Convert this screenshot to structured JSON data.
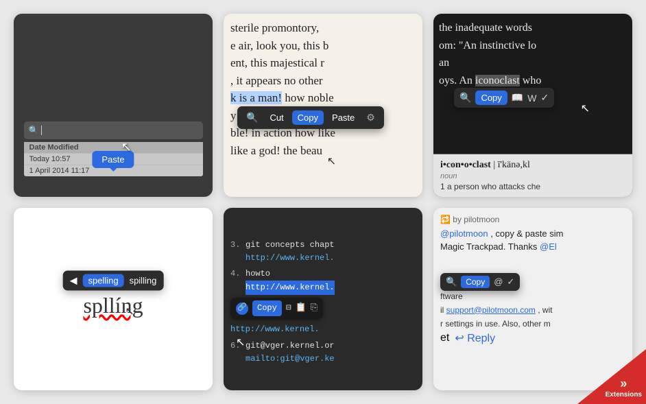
{
  "cards": {
    "card1": {
      "paste_label": "Paste",
      "search_placeholder": "",
      "file_header": "Date Modified",
      "file_row1": "Today 10:57",
      "file_row2": "1 April 2014 11:17"
    },
    "card2": {
      "text_lines": [
        "sterile promontory,",
        "e air, look you, this b",
        "ent, this majestical r",
        ", it appears no other",
        "k is a man!",
        " how noble",
        "y! in form and movi",
        "ble! in action how like",
        " like a god! the beau"
      ],
      "highlighted_text": "k is a man!",
      "menu_items": [
        "Cut",
        "Copy",
        "Paste"
      ],
      "menu_icon": "⚙",
      "search_icon": "🔍",
      "active_btn": "Copy"
    },
    "card3": {
      "text_lines": [
        "the inadequate words",
        "om: \"An instinctive lo",
        "an",
        "oys. An iconoclast who"
      ],
      "highlighted_word": "iconoclast",
      "toolbar": {
        "search_icon": "🔍",
        "copy_label": "Copy",
        "book_icon": "📖",
        "w_icon": "W",
        "check_icon": "✓",
        "active": "Copy"
      },
      "dict": {
        "headword": "i•con•o•clast",
        "pronunciation": "| ī'känə,kl",
        "pos": "noun",
        "definition": "1 a person who attacks che"
      }
    },
    "card4": {
      "tooltip": {
        "arrow": "◀",
        "word": "spelling",
        "suggestion": "spilling"
      },
      "misspelled": "spllíng"
    },
    "card5": {
      "lines": [
        {
          "number": "3.",
          "text": "  git concepts chapt",
          "url": "http://www.kernel."
        },
        {
          "number": "4.",
          "text": "  howto",
          "url": "http://www.kernel."
        },
        {
          "number": "6.",
          "text": "  git@vger.kernel.or",
          "url": "mailto:git@vger.ke"
        }
      ],
      "toolbar": {
        "copy_label": "Copy",
        "active": "Copy"
      }
    },
    "card6": {
      "retweet_icon": "🔁",
      "by_text": "by pilotmoon",
      "mention": "@pilotmoon",
      "tweet_text": ", copy & paste sim",
      "tweet_text2": "Magic Trackpad. Thanks @El",
      "label_ftware": "ftware",
      "label_il": "il",
      "email": "support@pilotmoon.com",
      "email_suffix": ", wit",
      "settings_text": "r settings in use. Also, other m",
      "et_text": "et",
      "reply_text": "↩ Reply",
      "toolbar": {
        "search_icon": "🔍",
        "copy_label": "Copy",
        "at_icon": "@",
        "check_icon": "✓",
        "active": "Copy"
      }
    },
    "extensions": {
      "arrows": "»",
      "label": "Extensions"
    }
  }
}
